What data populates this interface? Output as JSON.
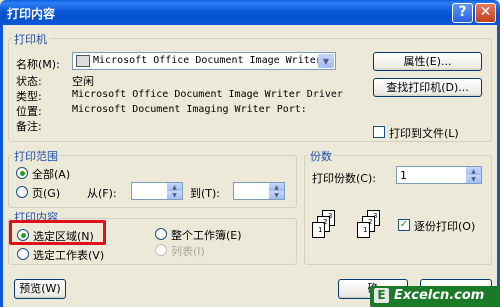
{
  "window": {
    "title": "打印内容",
    "help": "?",
    "close": "✕"
  },
  "printer": {
    "group_label": "打印机",
    "name_label": "名称(M):",
    "name_value": "Microsoft Office Document Image Writer",
    "status_label": "状态:",
    "status_value": "空闲",
    "type_label": "类型:",
    "type_value": "Microsoft Office Document Image Writer Driver",
    "where_label": "位置:",
    "where_value": "Microsoft Document Imaging Writer Port:",
    "comment_label": "备注:",
    "properties_button": "属性(E)...",
    "find_button": "查找打印机(D)...",
    "print_to_file": "打印到文件(L)"
  },
  "range": {
    "group_label": "打印范围",
    "all_label": "全部(A)",
    "pages_label": "页(G)",
    "from_label": "从(F):",
    "to_label": "到(T):",
    "from_value": "",
    "to_value": ""
  },
  "copies": {
    "group_label": "份数",
    "count_label": "打印份数(C):",
    "count_value": "1",
    "collate_label": "逐份打印(O)",
    "pages_1": "1",
    "pages_2": "2",
    "pages_3": "3"
  },
  "content": {
    "group_label": "打印内容",
    "selection_label": "选定区域(N)",
    "workbook_label": "整个工作簿(E)",
    "sheet_label": "选定工作表(V)",
    "list_label": "列表(I)"
  },
  "footer": {
    "preview_button": "预览(W)",
    "ok_button": "确",
    "watermark": "Excelcn.com"
  },
  "colors": {
    "titlebar": "#0a58d8",
    "highlight": "#e0101a",
    "legend": "#1f4fb0"
  }
}
